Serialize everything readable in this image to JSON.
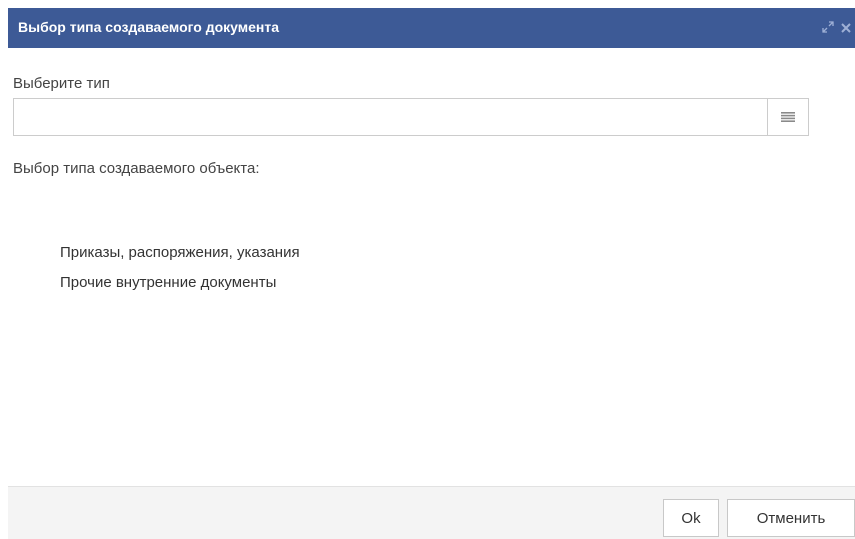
{
  "dialog": {
    "title": "Выбор типа создаваемого документа",
    "title_icons": [
      "expand-icon",
      "close-icon"
    ]
  },
  "form": {
    "field_label": "Выберите тип",
    "input_value": "",
    "list_button_icon": "list-icon",
    "section_label": "Выбор типа создаваемого объекта:"
  },
  "types": [
    {
      "label": "Приказы, распоряжения, указания"
    },
    {
      "label": "Прочие внутренние документы"
    }
  ],
  "footer": {
    "ok_label": "Ok",
    "cancel_label": "Отменить"
  },
  "colors": {
    "titlebar": "#3d5a96",
    "footer": "#f4f4f4"
  }
}
